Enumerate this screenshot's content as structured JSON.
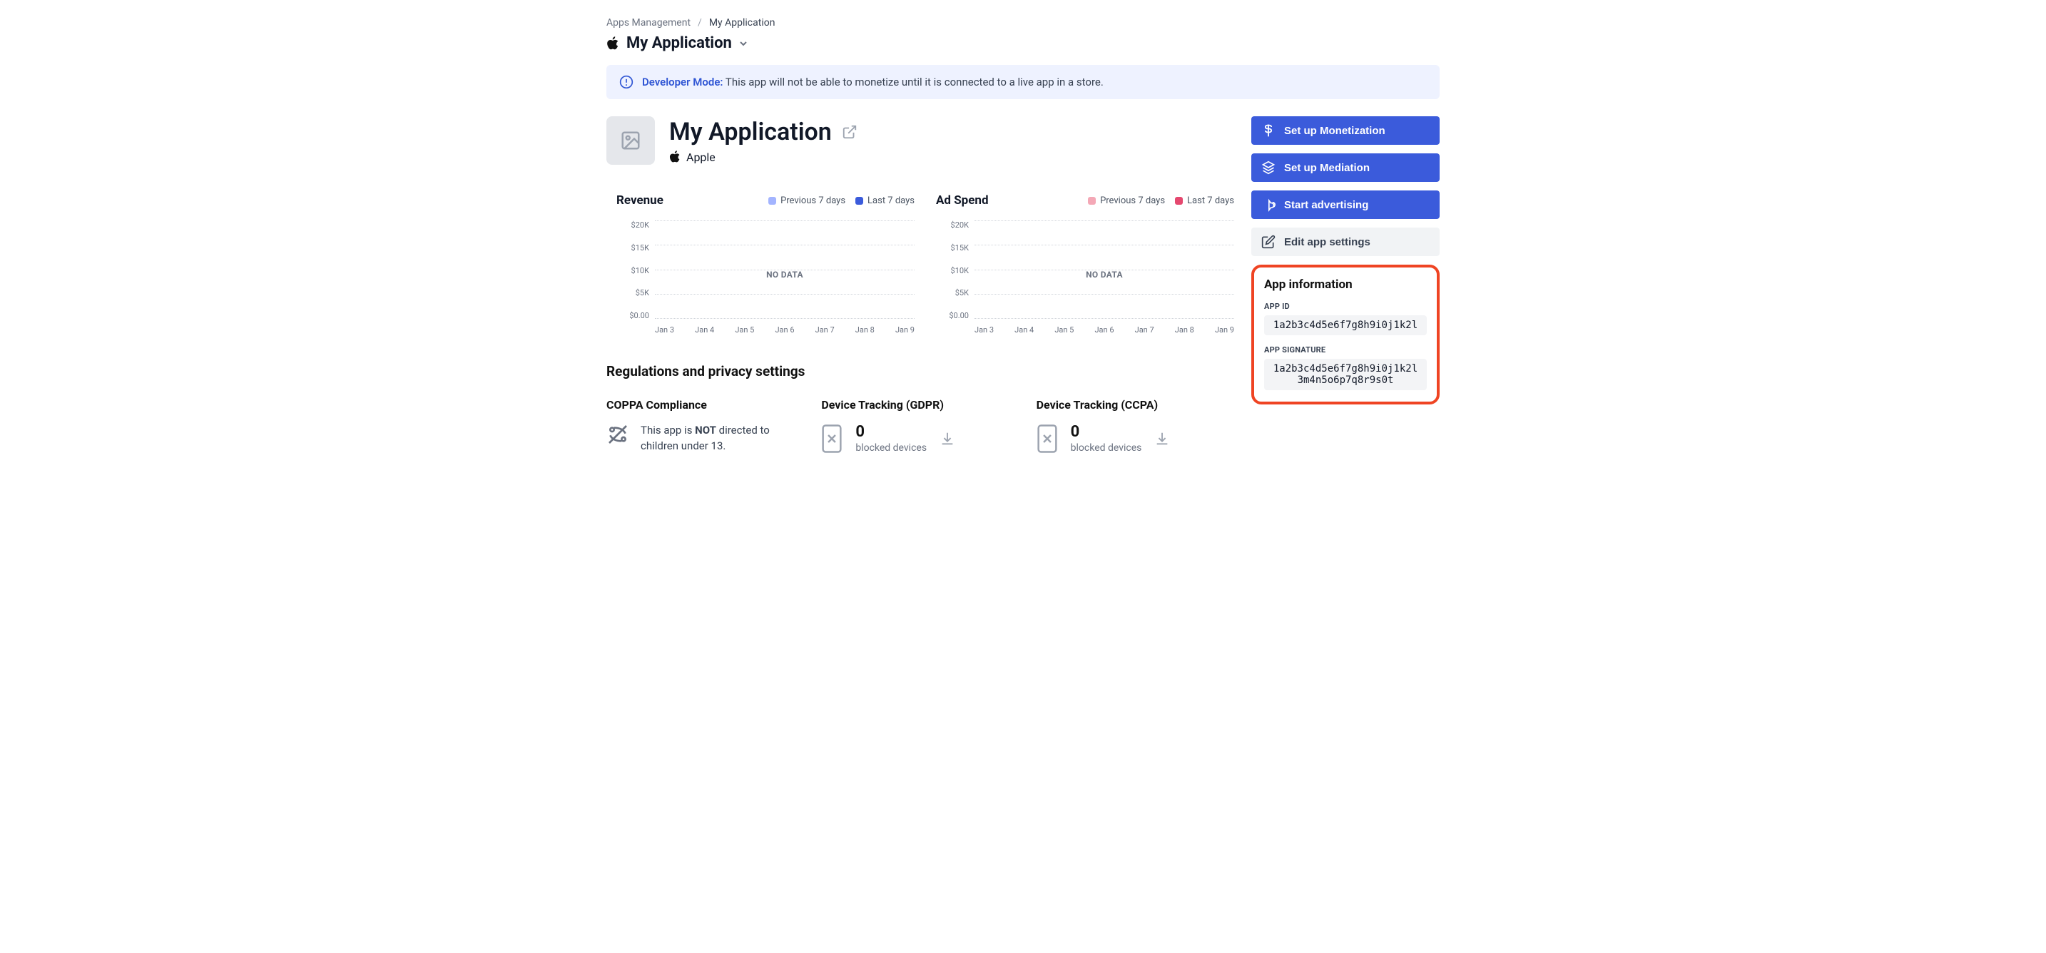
{
  "breadcrumb": {
    "parent": "Apps Management",
    "current": "My Application"
  },
  "header": {
    "app_name": "My Application"
  },
  "banner": {
    "label": "Developer Mode:",
    "text": "This app will not be able to monetize until it is connected to a live app in a store."
  },
  "app": {
    "title": "My Application",
    "platform": "Apple"
  },
  "legend": {
    "prev": "Previous 7 days",
    "last": "Last 7 days"
  },
  "colors": {
    "revenue_prev": "#a3b4ff",
    "revenue_last": "#3b5bdb",
    "spend_prev": "#f4a8b6",
    "spend_last": "#e5486f"
  },
  "chart_data": [
    {
      "id": "revenue",
      "type": "line",
      "title": "Revenue",
      "no_data": "NO DATA",
      "ylabel": "",
      "xlabel": "",
      "ylim": [
        0,
        20000
      ],
      "y_ticks": [
        "$20K",
        "$15K",
        "$10K",
        "$5K",
        "$0.00"
      ],
      "categories": [
        "Jan 3",
        "Jan 4",
        "Jan 5",
        "Jan 6",
        "Jan 7",
        "Jan 8",
        "Jan 9"
      ],
      "series": [
        {
          "name": "Previous 7 days",
          "color_key": "revenue_prev",
          "values": [
            null,
            null,
            null,
            null,
            null,
            null,
            null
          ]
        },
        {
          "name": "Last 7 days",
          "color_key": "revenue_last",
          "values": [
            null,
            null,
            null,
            null,
            null,
            null,
            null
          ]
        }
      ]
    },
    {
      "id": "adspend",
      "type": "line",
      "title": "Ad Spend",
      "no_data": "NO DATA",
      "ylabel": "",
      "xlabel": "",
      "ylim": [
        0,
        20000
      ],
      "y_ticks": [
        "$20K",
        "$15K",
        "$10K",
        "$5K",
        "$0.00"
      ],
      "categories": [
        "Jan 3",
        "Jan 4",
        "Jan 5",
        "Jan 6",
        "Jan 7",
        "Jan 8",
        "Jan 9"
      ],
      "series": [
        {
          "name": "Previous 7 days",
          "color_key": "spend_prev",
          "values": [
            null,
            null,
            null,
            null,
            null,
            null,
            null
          ]
        },
        {
          "name": "Last 7 days",
          "color_key": "spend_last",
          "values": [
            null,
            null,
            null,
            null,
            null,
            null,
            null
          ]
        }
      ]
    }
  ],
  "actions": {
    "monetize": "Set up Monetization",
    "mediation": "Set up Mediation",
    "advertise": "Start advertising",
    "edit": "Edit app settings"
  },
  "info": {
    "title": "App information",
    "app_id_label": "APP ID",
    "app_id": "1a2b3c4d5e6f7g8h9i0j1k2l",
    "sig_label": "APP SIGNATURE",
    "sig": "1a2b3c4d5e6f7g8h9i0j1k2l3m4n5o6p7q8r9s0t"
  },
  "regulations": {
    "title": "Regulations and privacy settings",
    "coppa_title": "COPPA Compliance",
    "coppa_pre": "This app is ",
    "coppa_not": "NOT",
    "coppa_post": " directed to children under 13.",
    "gdpr_title": "Device Tracking (GDPR)",
    "gdpr_count": "0",
    "gdpr_sub": "blocked devices",
    "ccpa_title": "Device Tracking (CCPA)",
    "ccpa_count": "0",
    "ccpa_sub": "blocked devices"
  }
}
